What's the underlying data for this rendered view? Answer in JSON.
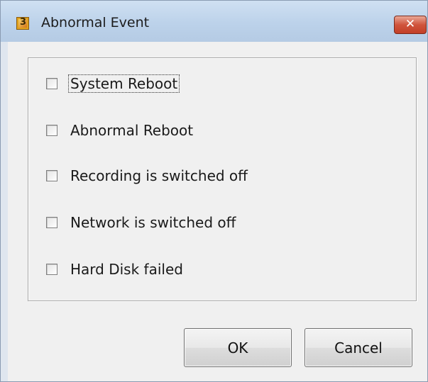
{
  "window": {
    "title": "Abnormal Event",
    "close_label": "✕"
  },
  "options": [
    {
      "label": "System Reboot",
      "checked": false
    },
    {
      "label": "Abnormal Reboot",
      "checked": false
    },
    {
      "label": "Recording is switched off",
      "checked": false
    },
    {
      "label": "Network is switched off",
      "checked": false
    },
    {
      "label": "Hard Disk failed",
      "checked": false
    }
  ],
  "buttons": {
    "ok": "OK",
    "cancel": "Cancel"
  },
  "colors": {
    "titlebar": "#bcd2ea",
    "close_button": "#d0543c",
    "client_background": "#f0f0f0"
  }
}
